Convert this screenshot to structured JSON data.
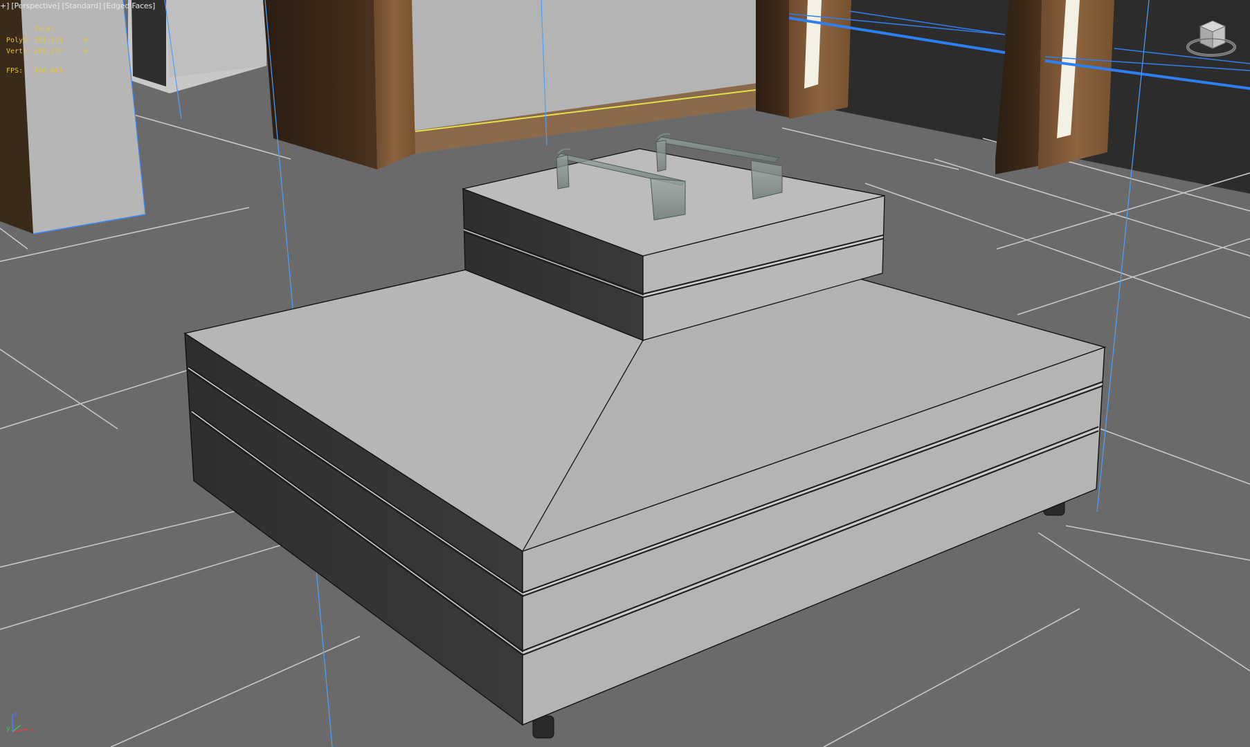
{
  "viewport": {
    "label_parts": [
      "+",
      "Perspective",
      "Standard",
      "Edged Faces"
    ]
  },
  "stats": {
    "header": "Total",
    "rows": [
      {
        "label": "Polys:",
        "total": "391,531",
        "selected": "0"
      },
      {
        "label": "Verts:",
        "total": "285,237",
        "selected": "0"
      }
    ],
    "fps_label": "FPS:",
    "fps_value": "166,001"
  },
  "axis": {
    "x": "x",
    "y": "y",
    "z": "z"
  },
  "colors": {
    "floor": "#6b6b6b",
    "grid_line": "#c4c4c4",
    "panel_gray": "#b0b0b0",
    "wood_dark": "#3a2a1c",
    "wood_light": "#8a6440",
    "wall_dark": "#2d2d2d",
    "glass_blue": "#2f7ff0",
    "stats_text": "#e3c341"
  },
  "icons": [
    "viewcube-icon",
    "axis-tripod-icon"
  ]
}
